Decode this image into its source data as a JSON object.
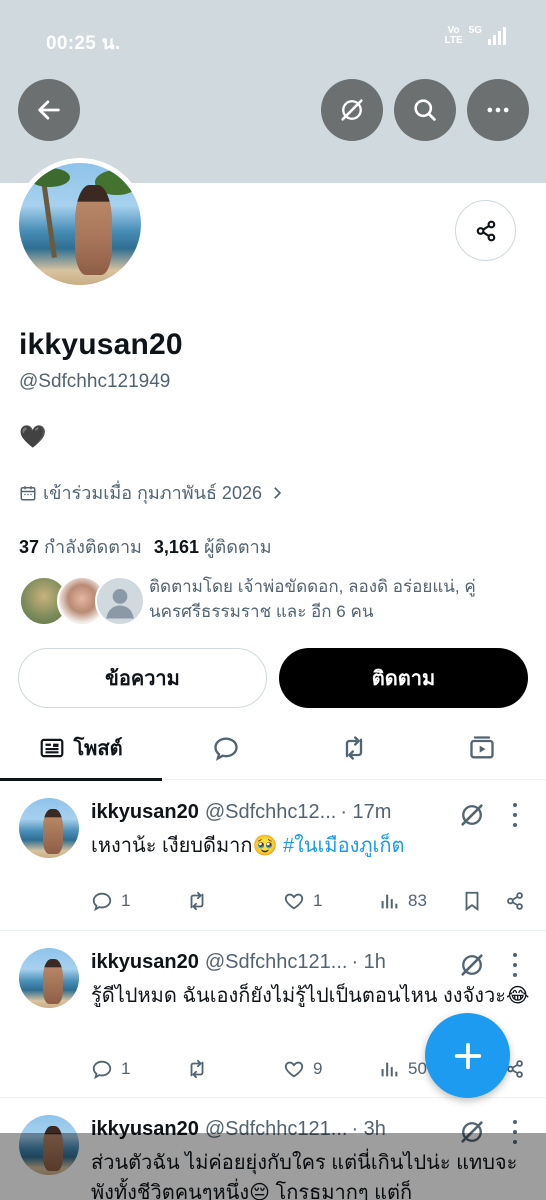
{
  "status_bar": {
    "time": "00:25 น.",
    "volte_top": "Vo",
    "volte_bottom": "LTE",
    "network": "5G"
  },
  "header": {
    "back_icon": "arrow-left-icon",
    "grok_icon": "grok-slash-icon",
    "search_icon": "search-icon",
    "more_icon": "more-horizontal-icon"
  },
  "profile": {
    "display_name": "ikkyusan20",
    "handle": "@Sdfchhc121949",
    "bio": "🖤",
    "joined": "เข้าร่วมเมื่อ กุมภาพันธ์ 2026",
    "following_count": "37",
    "following_label": "กำลังติดตาม",
    "followers_count": "3,161",
    "followers_label": "ผู้ติดตาม",
    "followed_by": "ติดตามโดย เจ้าพ่อขัดดอก, ลองดิ อร่อยแน่, คู่นครศรีธรรมราช และ อีก 6 คน",
    "message_button": "ข้อความ",
    "follow_button": "ติดตาม"
  },
  "tabs": [
    {
      "label": "โพสต์",
      "icon": "posts-icon",
      "active": true
    },
    {
      "label": "",
      "icon": "replies-icon",
      "active": false
    },
    {
      "label": "",
      "icon": "reposts-icon",
      "active": false
    },
    {
      "label": "",
      "icon": "media-icon",
      "active": false
    }
  ],
  "posts": [
    {
      "name": "ikkyusan20",
      "handle": "@Sdfchhc12...",
      "time": "· 17m",
      "text": "เหงาน้ะ เงียบดีมาก🥹 ",
      "hashtag": "#ในเมืองภูเก็ต",
      "replies": "1",
      "reposts": "",
      "likes": "1",
      "views": "83"
    },
    {
      "name": "ikkyusan20",
      "handle": "@Sdfchhc121...",
      "time": "· 1h",
      "text": "รู้ดีไปหมด ฉันเองก็ยังไม่รู้ไปเป็นตอนไหน  งงจังวะ😂",
      "hashtag": "",
      "replies": "1",
      "reposts": "",
      "likes": "9",
      "views": "50"
    },
    {
      "name": "ikkyusan20",
      "handle": "@Sdfchhc121...",
      "time": "· 3h",
      "text": "ส่วนตัวฉัน ไม่ค่อยยุ่งกับใคร แต่นี่เกินไปน่ะ แทบจะพังทั้งชีวิตคนๆหนึ่ง😔 โกรธมากๆ แต่ก็",
      "hashtag": "",
      "replies": "",
      "reposts": "",
      "likes": "",
      "views": ""
    }
  ],
  "fab": {
    "icon": "plus-icon"
  },
  "colors": {
    "accent": "#1d9bf0",
    "banner": "#cfd9de",
    "muted": "#536471"
  }
}
